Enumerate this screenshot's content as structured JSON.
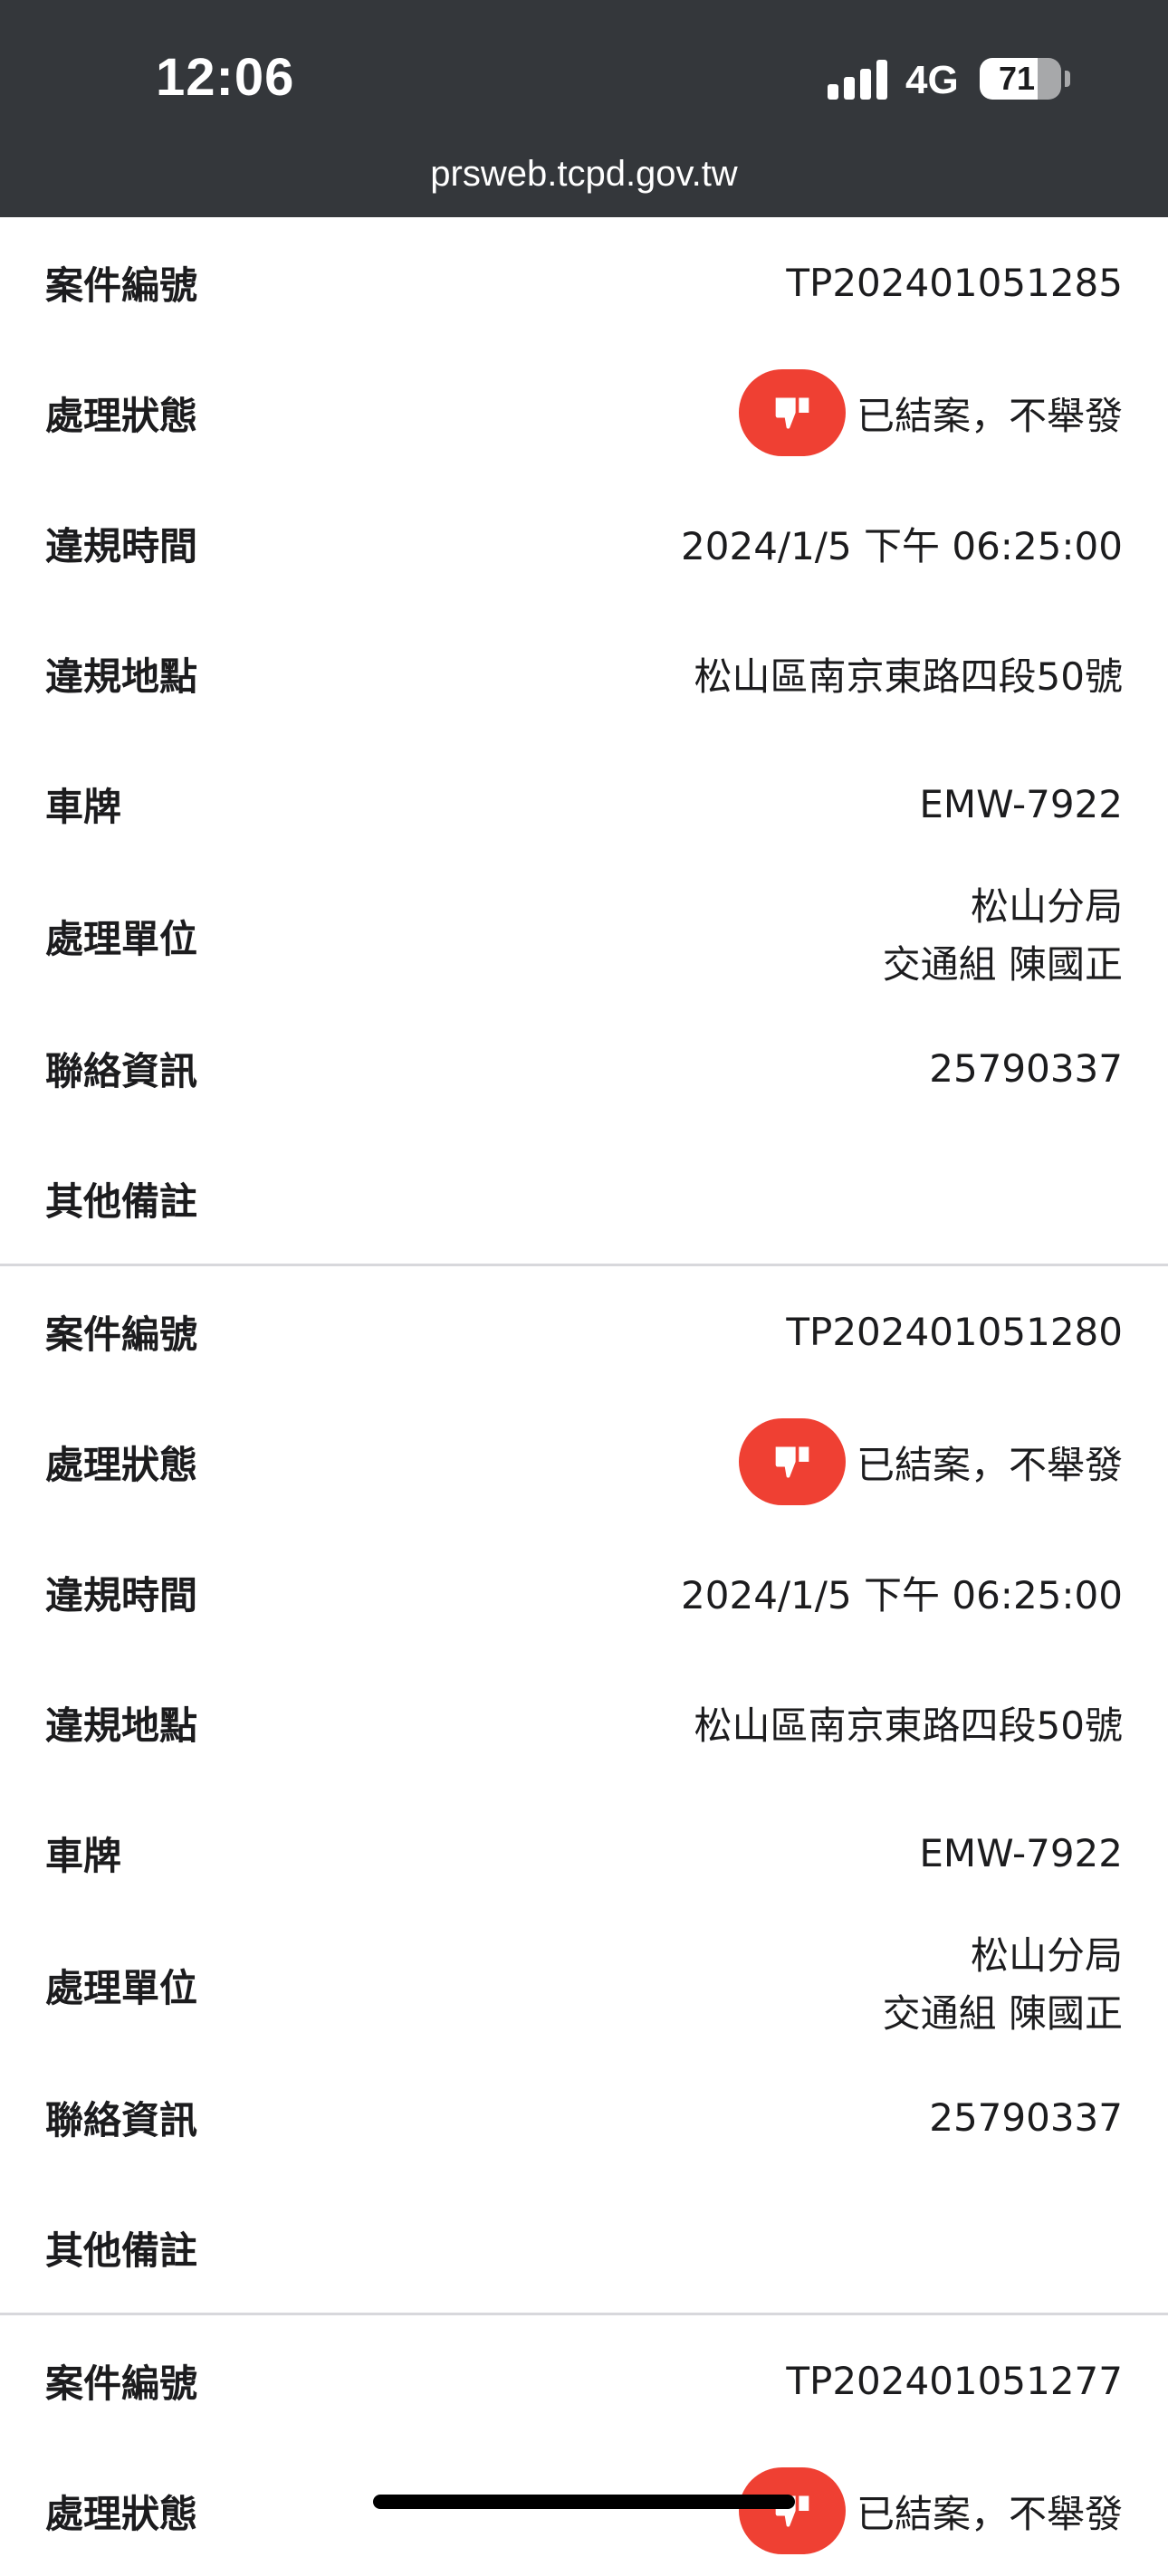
{
  "status_bar": {
    "time": "12:06",
    "network": "4G",
    "battery_percent": "71",
    "battery_level": 0.71
  },
  "browser": {
    "url": "prsweb.tcpd.gov.tw"
  },
  "labels": {
    "case_number": "案件編號",
    "status": "處理狀態",
    "violation_time": "違規時間",
    "violation_location": "違規地點",
    "license_plate": "車牌",
    "handling_unit": "處理單位",
    "contact": "聯絡資訊",
    "notes": "其他備註"
  },
  "records": [
    {
      "case_number": "TP202401051285",
      "status_icon": "thumbs-down-icon",
      "status": "已結案，不舉發",
      "violation_time": "2024/1/5 下午 06:25:00",
      "violation_location": "松山區南京東路四段50號",
      "license_plate": "EMW-7922",
      "handling_unit_line1": "松山分局",
      "handling_unit_line2": "交通組 陳國正",
      "contact": "25790337",
      "notes": ""
    },
    {
      "case_number": "TP202401051280",
      "status_icon": "thumbs-down-icon",
      "status": "已結案，不舉發",
      "violation_time": "2024/1/5 下午 06:25:00",
      "violation_location": "松山區南京東路四段50號",
      "license_plate": "EMW-7922",
      "handling_unit_line1": "松山分局",
      "handling_unit_line2": "交通組 陳國正",
      "contact": "25790337",
      "notes": ""
    },
    {
      "case_number": "TP202401051277",
      "status_icon": "thumbs-down-icon",
      "status": "已結案，不舉發"
    }
  ],
  "colors": {
    "status_bar_bg": "#34373b",
    "status_icon_bg": "#ef4033",
    "divider": "#d8d8dc"
  }
}
